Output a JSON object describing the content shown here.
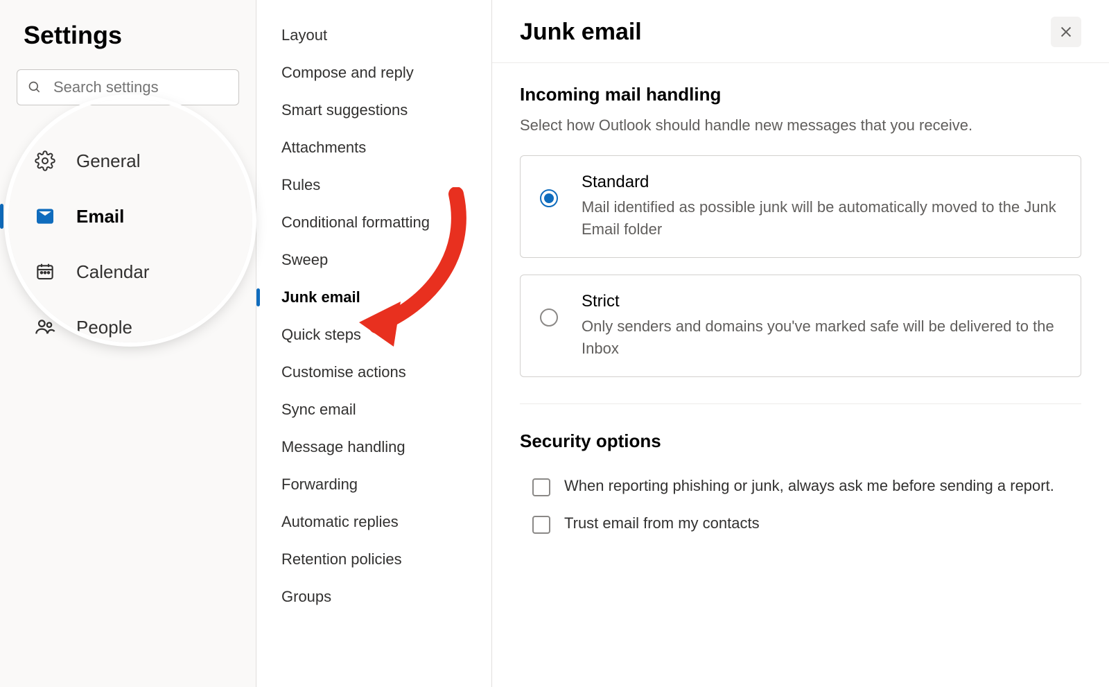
{
  "settings_title": "Settings",
  "search_placeholder": "Search settings",
  "categories": [
    {
      "label": "General"
    },
    {
      "label": "Email"
    },
    {
      "label": "Calendar"
    },
    {
      "label": "People"
    }
  ],
  "subnav": [
    "Layout",
    "Compose and reply",
    "Smart suggestions",
    "Attachments",
    "Rules",
    "Conditional formatting",
    "Sweep",
    "Junk email",
    "Quick steps",
    "Customise actions",
    "Sync email",
    "Message handling",
    "Forwarding",
    "Automatic replies",
    "Retention policies",
    "Groups"
  ],
  "main": {
    "title": "Junk email",
    "incoming": {
      "heading": "Incoming mail handling",
      "desc": "Select how Outlook should handle new messages that you receive.",
      "standard": {
        "title": "Standard",
        "desc": "Mail identified as possible junk will be automatically moved to the Junk Email folder"
      },
      "strict": {
        "title": "Strict",
        "desc": "Only senders and domains you've marked safe will be delivered to the Inbox"
      }
    },
    "security": {
      "heading": "Security options",
      "opt1": "When reporting phishing or junk, always ask me before sending a report.",
      "opt2": "Trust email from my contacts"
    }
  }
}
